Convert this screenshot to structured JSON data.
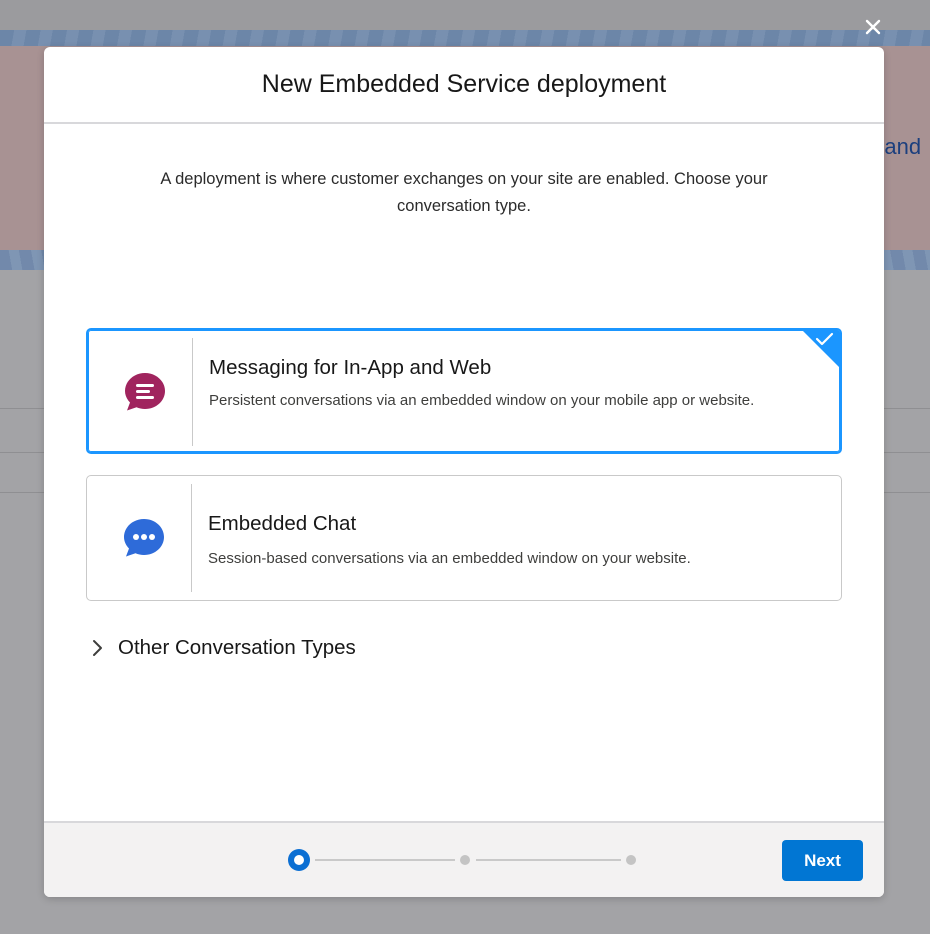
{
  "background": {
    "hero_text": "e and"
  },
  "modal": {
    "title": "New Embedded Service deployment",
    "intro": "A deployment is where customer exchanges on your site are enabled. Choose your conversation type.",
    "options": [
      {
        "title": "Messaging for In-App and Web",
        "description": "Persistent conversations via an embedded window on your mobile app or website.",
        "icon": "messaging-icon",
        "icon_color": "#a0245e",
        "selected": true
      },
      {
        "title": "Embedded Chat",
        "description": "Session-based conversations via an embedded window on your website.",
        "icon": "chat-icon",
        "icon_color": "#2e6bd9",
        "selected": false
      }
    ],
    "other_types_label": "Other Conversation Types"
  },
  "footer": {
    "progress": {
      "current_step": 1,
      "total_steps": 3
    },
    "next_label": "Next"
  },
  "colors": {
    "accent": "#0176d3",
    "selected_border": "#1b96ff"
  }
}
